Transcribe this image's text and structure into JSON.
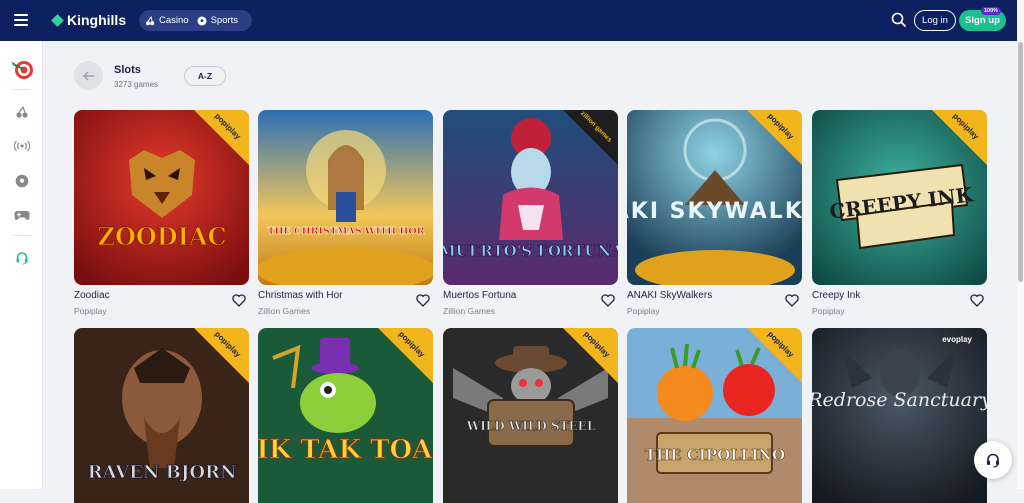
{
  "header": {
    "logo_text": "Kinghills",
    "modes": [
      {
        "label": "Casino",
        "icon": "cherries-icon"
      },
      {
        "label": "Sports",
        "icon": "soccer-ball-icon"
      }
    ],
    "login_label": "Log in",
    "signup_label": "Sign up",
    "signup_badge": "100%"
  },
  "sidebar": {
    "items": [
      {
        "name": "target-darts-icon"
      },
      {
        "name": "cherries-icon"
      },
      {
        "name": "live-broadcast-icon"
      },
      {
        "name": "soccer-ball-icon"
      },
      {
        "name": "gamepad-icon"
      },
      {
        "name": "headset-support-icon"
      }
    ]
  },
  "page": {
    "title": "Slots",
    "count": "3273 games",
    "sort_label": "A-Z"
  },
  "games": [
    {
      "name": "Zoodiac",
      "provider": "Popiplay",
      "art_text": "ZOODIAC",
      "ribbon": "popiplay"
    },
    {
      "name": "Christmas with Hor",
      "provider": "Zillion Games",
      "art_text": "THE CHRISTMAS WITH HOR",
      "ribbon": ""
    },
    {
      "name": "Muertos Fortuna",
      "provider": "Zillion Games",
      "art_text": "MUERTO'S FORTUNA",
      "ribbon": "zillion games"
    },
    {
      "name": "ANAKI SkyWalkers",
      "provider": "Popiplay",
      "art_text": "ANAKI SKYWALKERS",
      "ribbon": "popiplay"
    },
    {
      "name": "Creepy Ink",
      "provider": "Popiplay",
      "art_text": "CREEPY INK",
      "ribbon": "popiplay"
    },
    {
      "name": "",
      "provider": "",
      "art_text": "RAVEN BJORN",
      "ribbon": "popiplay"
    },
    {
      "name": "",
      "provider": "",
      "art_text": "TIK TAK TOAD",
      "ribbon": "popiplay"
    },
    {
      "name": "",
      "provider": "",
      "art_text": "WILD WILD STEEL",
      "ribbon": "popiplay"
    },
    {
      "name": "",
      "provider": "",
      "art_text": "THE CIPOLLINO",
      "ribbon": "popiplay"
    },
    {
      "name": "",
      "provider": "",
      "art_text": "Redrose Sanctuary",
      "ribbon": "evoplay"
    }
  ],
  "colors": {
    "header": "#0d2160",
    "accent": "#1ac08e",
    "page_bg": "#f0f2f5"
  }
}
